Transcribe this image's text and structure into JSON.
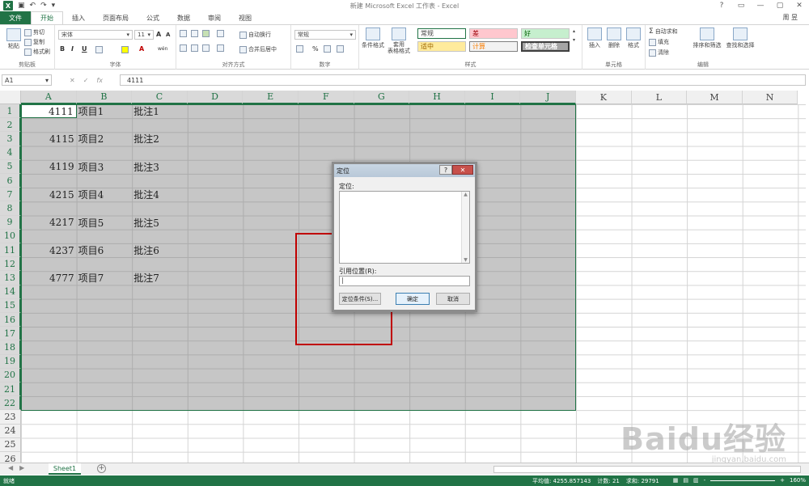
{
  "window": {
    "title": "新建 Microsoft Excel 工作表 - Excel",
    "user": "周 昱",
    "controls": [
      "?",
      "▭",
      "—",
      "▢",
      "✕"
    ]
  },
  "tabs": [
    {
      "label": "文件",
      "kind": "file"
    },
    {
      "label": "开始",
      "kind": "active"
    },
    {
      "label": "插入"
    },
    {
      "label": "页面布局"
    },
    {
      "label": "公式"
    },
    {
      "label": "数据"
    },
    {
      "label": "审阅"
    },
    {
      "label": "视图"
    }
  ],
  "ribbon": {
    "clipboard": {
      "label": "剪贴板",
      "paste": "粘贴",
      "cut": "剪切",
      "copy": "复制",
      "format_painter": "格式刷"
    },
    "font": {
      "label": "字体",
      "name": "宋体",
      "size": "11",
      "bold": "B",
      "italic": "I",
      "underline": "U",
      "grow": "A",
      "shrink": "A",
      "wen": "wén",
      "fill": "A"
    },
    "alignment": {
      "label": "对齐方式",
      "wrap": "自动换行",
      "merge": "合并后居中"
    },
    "number": {
      "label": "数字",
      "format": "常规",
      "percent": "%"
    },
    "styles": {
      "label": "样式",
      "conditional": "条件格式",
      "table": "套用\n表格格式",
      "cells": [
        {
          "label": "常规"
        },
        {
          "label": "差"
        },
        {
          "label": "好"
        },
        {
          "label": "适中"
        },
        {
          "label": "计算"
        },
        {
          "label": "检查单元格"
        }
      ]
    },
    "cells": {
      "label": "单元格",
      "insert": "插入",
      "delete": "删除",
      "format": "格式"
    },
    "editing": {
      "label": "编辑",
      "autosum": "自动求和",
      "fill": "填充",
      "clear": "清除",
      "sort": "排序和筛选",
      "find": "查找和选择"
    }
  },
  "formula_bar": {
    "name_box": "A1",
    "cancel": "✕",
    "enter": "✓",
    "fx": "fx",
    "value": "4111"
  },
  "columns": [
    "A",
    "B",
    "C",
    "D",
    "E",
    "F",
    "G",
    "H",
    "I",
    "J",
    "K",
    "L",
    "M",
    "N"
  ],
  "rows": [
    "1",
    "2",
    "3",
    "4",
    "5",
    "6",
    "7",
    "8",
    "9",
    "10",
    "11",
    "12",
    "13",
    "14",
    "15",
    "16",
    "17",
    "18",
    "19",
    "20",
    "21",
    "22",
    "23",
    "24",
    "25",
    "26"
  ],
  "data_rows": [
    {
      "row": 1,
      "a": "4111",
      "b": "项目1",
      "c": "批注1"
    },
    {
      "row": 3,
      "a": "4115",
      "b": "项目2",
      "c": "批注2"
    },
    {
      "row": 5,
      "a": "4119",
      "b": "项目3",
      "c": "批注3"
    },
    {
      "row": 7,
      "a": "4215",
      "b": "项目4",
      "c": "批注4"
    },
    {
      "row": 9,
      "a": "4217",
      "b": "项目5",
      "c": "批注5"
    },
    {
      "row": 11,
      "a": "4237",
      "b": "项目6",
      "c": "批注6"
    },
    {
      "row": 13,
      "a": "4777",
      "b": "项目7",
      "c": "批注7"
    }
  ],
  "sheet": {
    "tab": "Sheet1",
    "add": "+",
    "nav_prev": "◀",
    "nav_next": "▶"
  },
  "status": {
    "ready": "就绪",
    "average": "平均值: 4255.857143",
    "count": "计数: 21",
    "sum": "求和: 29791",
    "zoom": "160%",
    "minus": "-",
    "plus": "+"
  },
  "dialog": {
    "title": "定位",
    "help": "?",
    "close": "✕",
    "goto_label": "定位:",
    "reference_label": "引用位置(R):",
    "reference_value": "|",
    "special_button": "定位条件(S)...",
    "ok_button": "确定",
    "cancel_button": "取消"
  },
  "watermark": {
    "main": "Baidu经验",
    "sub": "jingyan.baidu.com"
  }
}
